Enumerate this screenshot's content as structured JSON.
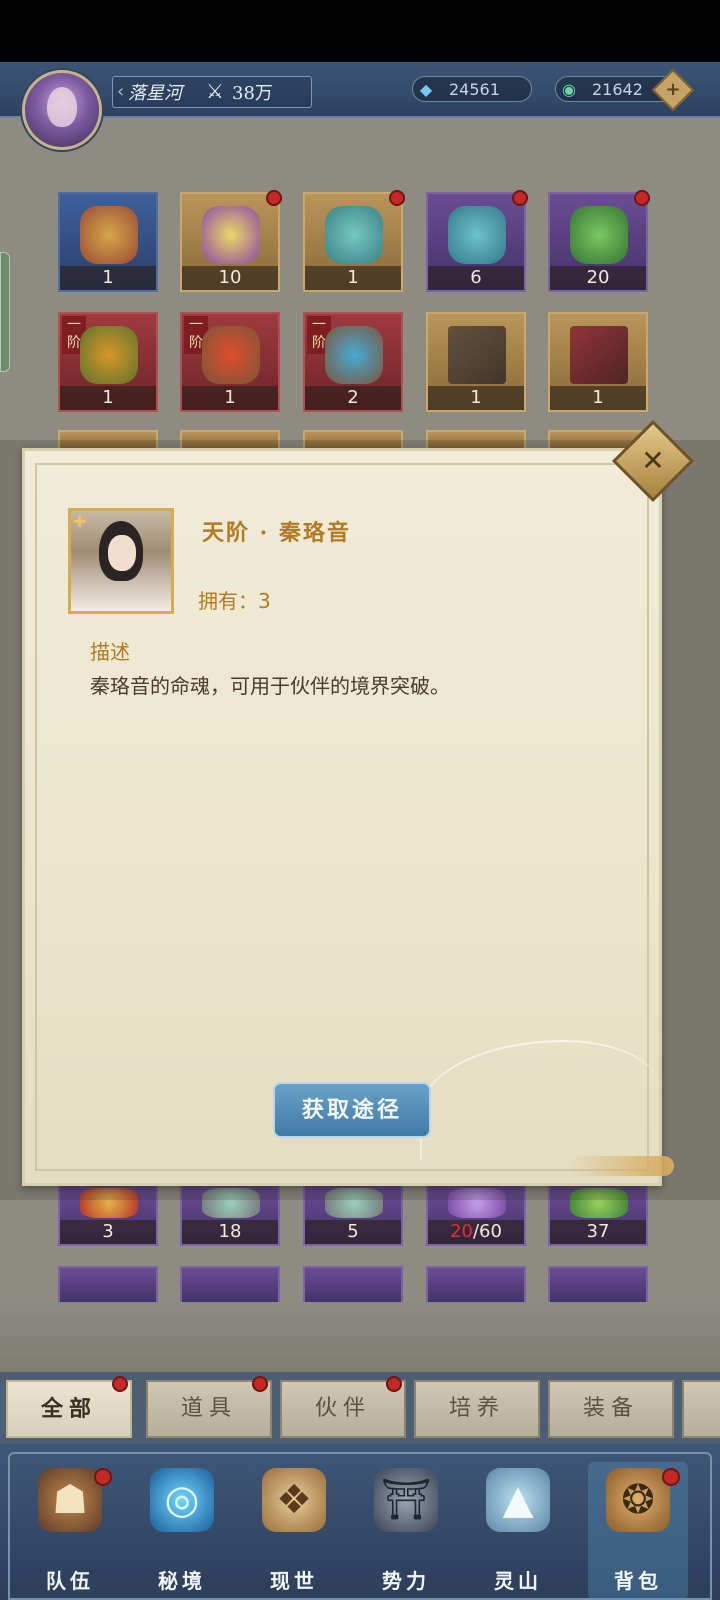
{
  "header": {
    "player_name": "落星河",
    "power": "38万",
    "currency_1": {
      "value": "24561",
      "icon": "crystal-icon",
      "color": "#7cc3ef"
    },
    "currency_2": {
      "value": "21642",
      "icon": "jade-coin-icon",
      "color": "#6fd2a0"
    }
  },
  "grid": {
    "row1": [
      {
        "count": "1",
        "icon": "scroll-ornament-icon",
        "badge": false
      },
      {
        "count": "10",
        "icon": "purple-crystal-icon",
        "badge": true
      },
      {
        "count": "1",
        "icon": "treasure-bag-icon",
        "badge": true
      },
      {
        "count": "6",
        "icon": "treasure-bag-icon",
        "badge": true
      },
      {
        "count": "20",
        "icon": "green-chest-icon",
        "badge": true
      }
    ],
    "row2": [
      {
        "count": "1",
        "tier_top": "一",
        "tier_bottom": "阶",
        "icon": "pill-leaf-icon"
      },
      {
        "count": "1",
        "tier_top": "一",
        "tier_bottom": "阶",
        "icon": "red-pill-icon"
      },
      {
        "count": "2",
        "tier_top": "一",
        "tier_bottom": "阶",
        "icon": "blue-pill-icon"
      },
      {
        "count": "1",
        "icon": "book-icon"
      },
      {
        "count": "1",
        "icon": "book-icon"
      }
    ],
    "row3": [
      {
        "count": "3",
        "icon": "talisman-icon"
      },
      {
        "count": "18",
        "icon": "jade-ore-icon"
      },
      {
        "count": "5",
        "icon": "jade-ore-icon"
      },
      {
        "count_red": "20",
        "count_rest": "/60",
        "icon": "spirit-crystal-icon"
      },
      {
        "count": "37",
        "icon": "green-beast-icon"
      }
    ]
  },
  "modal": {
    "title": "天阶 · 秦珞音",
    "owned": "拥有：3",
    "desc_label": "描述",
    "desc_text": "秦珞音的命魂，可用于伙伴的境界突破。",
    "button": "获取途径"
  },
  "tabs": [
    {
      "label": "全部",
      "active": true,
      "badge": true
    },
    {
      "label": "道具",
      "badge": true
    },
    {
      "label": "伙伴",
      "badge": true
    },
    {
      "label": "培养",
      "badge": false
    },
    {
      "label": "装备",
      "badge": false
    }
  ],
  "nav": [
    {
      "label": "队伍",
      "icon": "team-icon",
      "badge": true
    },
    {
      "label": "秘境",
      "icon": "vortex-icon",
      "badge": false
    },
    {
      "label": "现世",
      "icon": "scroll-map-icon",
      "badge": false
    },
    {
      "label": "势力",
      "icon": "palace-icon",
      "badge": false
    },
    {
      "label": "灵山",
      "icon": "mountain-icon",
      "badge": false
    },
    {
      "label": "背包",
      "icon": "bag-icon",
      "badge": true,
      "active": true
    }
  ]
}
